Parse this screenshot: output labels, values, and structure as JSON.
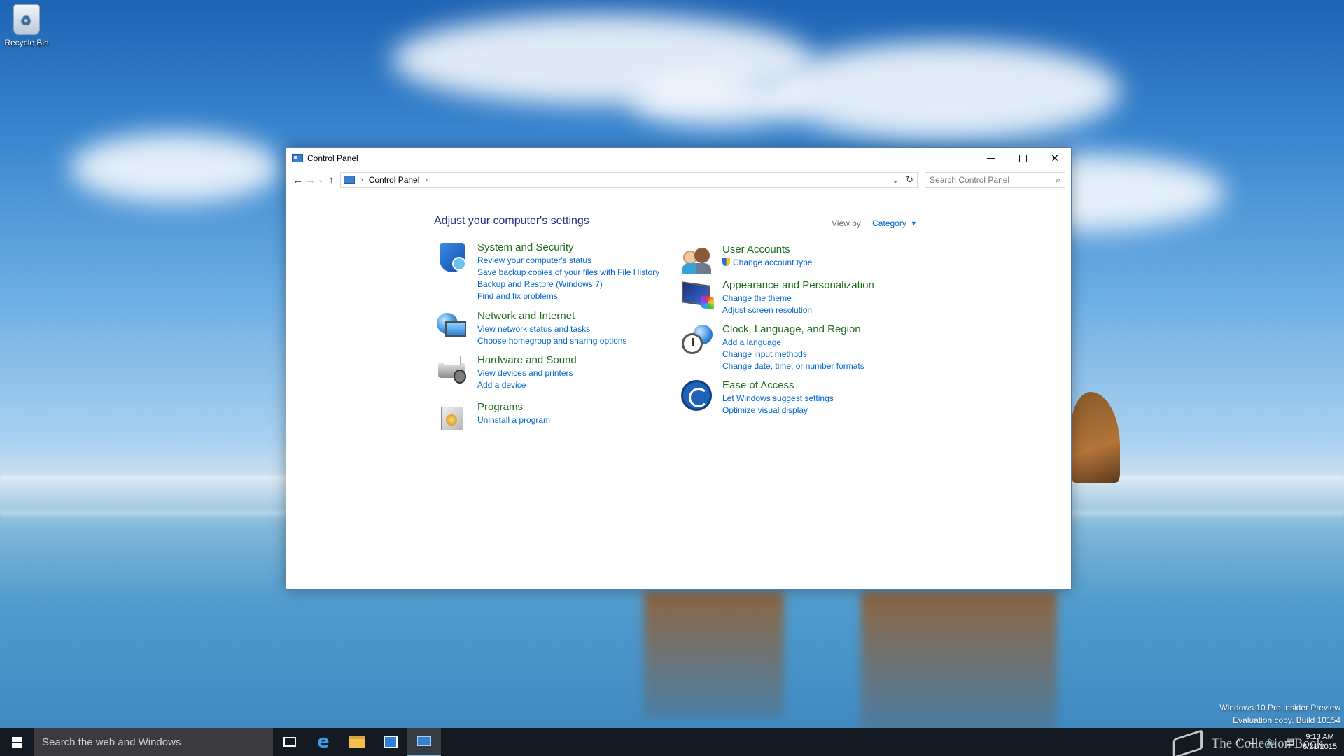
{
  "desktop": {
    "recycle_bin_label": "Recycle Bin"
  },
  "window": {
    "title": "Control Panel",
    "address": {
      "crumb": "Control Panel",
      "separator": "›"
    },
    "search_placeholder": "Search Control Panel",
    "heading": "Adjust your computer's settings",
    "view_by_label": "View by:",
    "view_by_value": "Category",
    "categories_left": [
      {
        "title": "System and Security",
        "icon": "shield-icon",
        "links": [
          "Review your computer's status",
          "Save backup copies of your files with File History",
          "Backup and Restore (Windows 7)",
          "Find and fix problems"
        ]
      },
      {
        "title": "Network and Internet",
        "icon": "network-globe-icon",
        "links": [
          "View network status and tasks",
          "Choose homegroup and sharing options"
        ]
      },
      {
        "title": "Hardware and Sound",
        "icon": "printer-speaker-icon",
        "links": [
          "View devices and printers",
          "Add a device"
        ]
      },
      {
        "title": "Programs",
        "icon": "programs-box-icon",
        "links": [
          "Uninstall a program"
        ]
      }
    ],
    "categories_right": [
      {
        "title": "User Accounts",
        "icon": "users-icon",
        "links": [
          "Change account type"
        ]
      },
      {
        "title": "Appearance and Personalization",
        "icon": "appearance-icon",
        "links": [
          "Change the theme",
          "Adjust screen resolution"
        ]
      },
      {
        "title": "Clock, Language, and Region",
        "icon": "clock-globe-icon",
        "links": [
          "Add a language",
          "Change input methods",
          "Change date, time, or number formats"
        ]
      },
      {
        "title": "Ease of Access",
        "icon": "ease-of-access-icon",
        "links": [
          "Let Windows suggest settings",
          "Optimize visual display"
        ]
      }
    ]
  },
  "taskbar": {
    "search_text": "Search the web and Windows",
    "time": "9:13 AM",
    "date": "6/21/2015"
  },
  "watermark": {
    "line1": "Windows 10 Pro Insider Preview",
    "line2": "Evaluation copy. Build 10154",
    "logo_text": "The Collection Book"
  },
  "colors": {
    "category_title": "#1c6e1c",
    "link": "#0066cc",
    "heading": "#1e3287",
    "taskbar": "#101014"
  }
}
